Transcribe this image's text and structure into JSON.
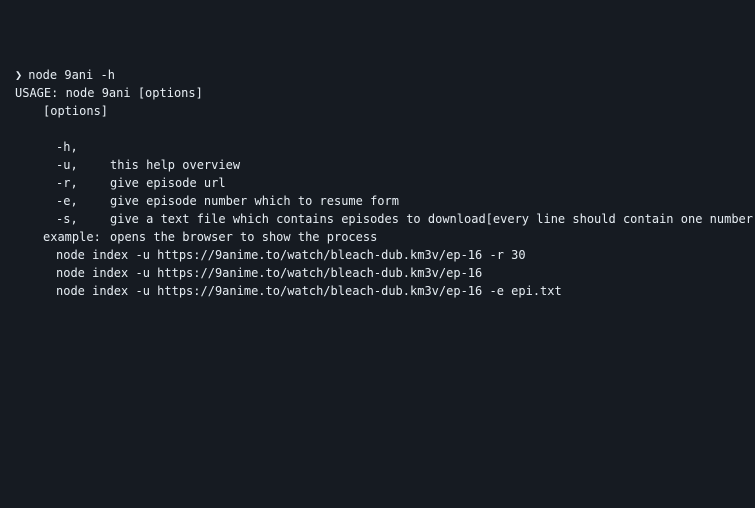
{
  "prompt": {
    "symbol": "❯",
    "command": "node 9ani -h"
  },
  "usage": "USAGE: node 9ani [options]",
  "options_header": "[options]",
  "options": [
    {
      "flag": "-h,",
      "description": "this help overview"
    },
    {
      "flag": "-u,",
      "description": "give episode url"
    },
    {
      "flag": "-r,",
      "description": "give episode number which to resume form"
    },
    {
      "flag": "-e,",
      "description": "give a text file which contains episodes to download[every line should contain one number"
    },
    {
      "flag": "-s,",
      "description": "opens the browser to show the process"
    }
  ],
  "example_header": "example:",
  "examples": [
    "node index -u https://9anime.to/watch/bleach-dub.km3v/ep-16 -r 30",
    "node index -u https://9anime.to/watch/bleach-dub.km3v/ep-16",
    "node index -u https://9anime.to/watch/bleach-dub.km3v/ep-16 -e epi.txt"
  ],
  "colors": {
    "background": "#161b22",
    "text": "#e6edf3"
  }
}
